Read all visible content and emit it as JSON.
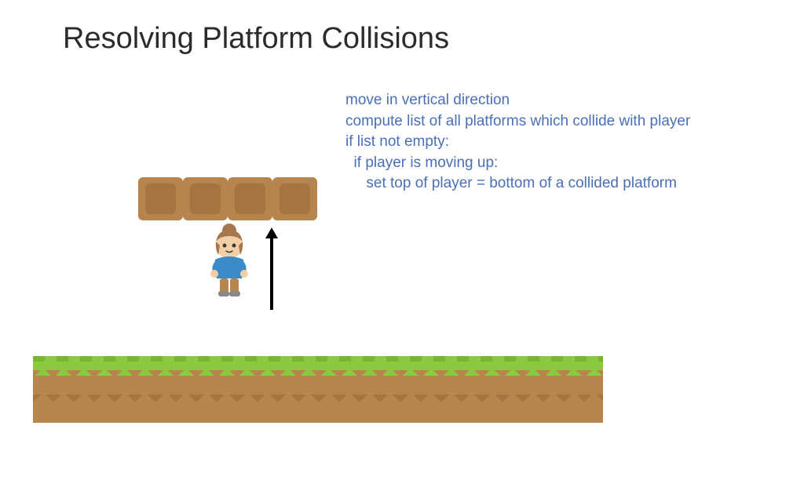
{
  "title": "Resolving Platform Collisions",
  "pseudocode": {
    "line1": "move in vertical direction",
    "line2": "compute list of all platforms which collide with player",
    "line3": "if list not empty:",
    "line4": "  if player is moving up:",
    "line5": "     set top of player = bottom of a collided platform"
  },
  "colors": {
    "text_dark": "#2b2b2b",
    "text_blue": "#4a6fb5",
    "block_outer": "#b7844e",
    "block_inner": "#a77441",
    "grass": "#8bca3e",
    "dirt": "#b7844e"
  }
}
